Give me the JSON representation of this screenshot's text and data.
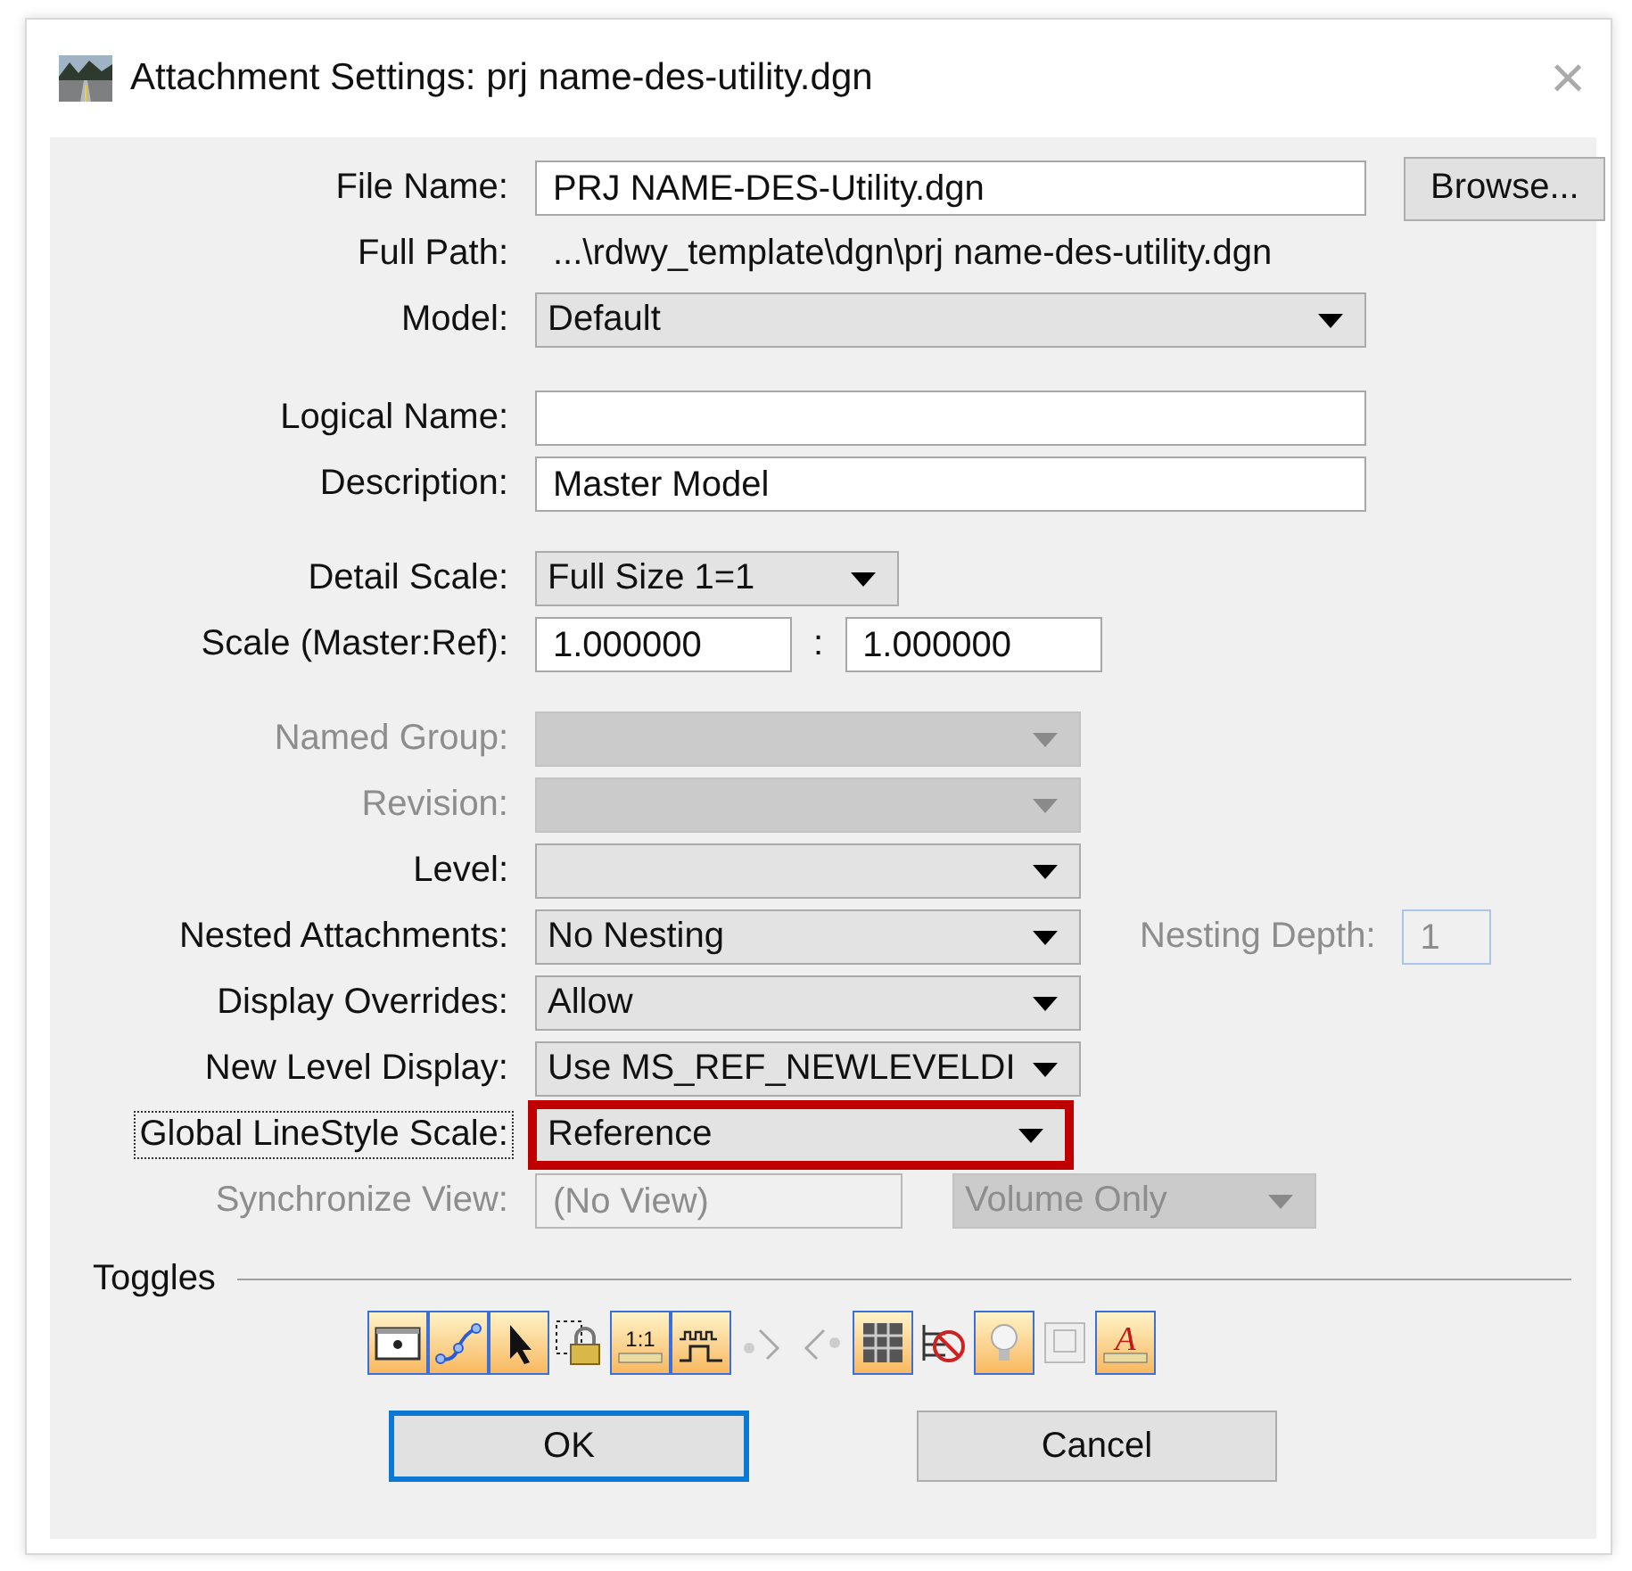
{
  "window": {
    "title": "Attachment Settings: prj name-des-utility.dgn",
    "close": "×"
  },
  "groups": [
    [
      {
        "label": "File Name:",
        "disabled": false,
        "focused": false,
        "controls": [
          {
            "kind": "text",
            "value": "PRJ NAME-DES-Utility.dgn",
            "disabled": false
          },
          {
            "kind": "button",
            "label": "Browse..."
          }
        ]
      },
      {
        "label": "Full Path:",
        "disabled": false,
        "focused": false,
        "controls": [
          {
            "kind": "static",
            "value": "...\\rdwy_template\\dgn\\prj name-des-utility.dgn"
          }
        ]
      },
      {
        "label": "Model:",
        "disabled": false,
        "focused": false,
        "controls": [
          {
            "kind": "combo",
            "value": "Default",
            "disabled": false,
            "highlighted": false
          }
        ]
      }
    ],
    [
      {
        "label": "Logical Name:",
        "disabled": false,
        "focused": false,
        "controls": [
          {
            "kind": "text",
            "disabled": false
          }
        ]
      },
      {
        "label": "Description:",
        "disabled": false,
        "focused": false,
        "controls": [
          {
            "kind": "text",
            "value": "Master Model",
            "disabled": false
          }
        ]
      }
    ],
    [
      {
        "label": "Detail Scale:",
        "disabled": false,
        "focused": false,
        "controls": [
          {
            "kind": "combo",
            "value": "Full Size 1=1",
            "disabled": false,
            "highlighted": false
          }
        ]
      },
      {
        "label": "Scale (Master:Ref):",
        "disabled": false,
        "focused": false,
        "controls": [
          {
            "kind": "text",
            "value": "1.000000",
            "disabled": false
          },
          {
            "kind": "separator",
            "value": ":"
          },
          {
            "kind": "text",
            "value": "1.000000",
            "disabled": false
          }
        ]
      }
    ],
    [
      {
        "label": "Named Group:",
        "disabled": true,
        "focused": false,
        "controls": [
          {
            "kind": "combo",
            "disabled": true,
            "highlighted": false
          }
        ]
      },
      {
        "label": "Revision:",
        "disabled": true,
        "focused": false,
        "controls": [
          {
            "kind": "combo",
            "disabled": true,
            "highlighted": false
          }
        ]
      },
      {
        "label": "Level:",
        "disabled": false,
        "focused": false,
        "controls": [
          {
            "kind": "combo",
            "disabled": false,
            "highlighted": false
          }
        ]
      },
      {
        "label": "Nested Attachments:",
        "disabled": false,
        "focused": false,
        "controls": [
          {
            "kind": "combo",
            "value": "No Nesting",
            "disabled": false,
            "highlighted": false
          },
          {
            "kind": "label",
            "value": "Nesting Depth:",
            "disabled": true
          },
          {
            "kind": "text",
            "value": "1",
            "disabled": true
          }
        ]
      },
      {
        "label": "Display Overrides:",
        "disabled": false,
        "focused": false,
        "controls": [
          {
            "kind": "combo",
            "value": "Allow",
            "disabled": false,
            "highlighted": false
          }
        ]
      },
      {
        "label": "New Level Display:",
        "disabled": false,
        "focused": false,
        "controls": [
          {
            "kind": "combo",
            "value": "Use MS_REF_NEWLEVELDI",
            "disabled": false,
            "highlighted": false
          }
        ]
      },
      {
        "label": "Global LineStyle Scale:",
        "disabled": false,
        "focused": true,
        "controls": [
          {
            "kind": "combo",
            "value": "Reference",
            "disabled": false,
            "highlighted": true
          }
        ]
      },
      {
        "label": "Synchronize View:",
        "disabled": true,
        "focused": false,
        "controls": [
          {
            "kind": "text",
            "value": "(No View)",
            "disabled": true
          },
          {
            "kind": "combo",
            "value": "Volume Only",
            "disabled": true,
            "highlighted": false
          }
        ]
      }
    ]
  ],
  "toggles_title": "Toggles",
  "toggles": [
    {
      "kind": "display",
      "on": true
    },
    {
      "kind": "snap",
      "on": true
    },
    {
      "kind": "locate",
      "on": true
    },
    {
      "kind": "lock",
      "on": false
    },
    {
      "kind": "scale",
      "on": true,
      "label": "1:1"
    },
    {
      "kind": "linestyle",
      "on": true
    },
    {
      "kind": "nose-left",
      "on": false
    },
    {
      "kind": "nose-right",
      "on": false
    },
    {
      "kind": "grid",
      "on": true
    },
    {
      "kind": "nolevel",
      "on": false
    },
    {
      "kind": "bulb",
      "on": true
    },
    {
      "kind": "frame",
      "on": false
    },
    {
      "kind": "text",
      "on": true,
      "label": "A"
    }
  ],
  "buttons": [
    {
      "label": "OK",
      "default": true
    },
    {
      "label": "Cancel",
      "default": false
    }
  ]
}
